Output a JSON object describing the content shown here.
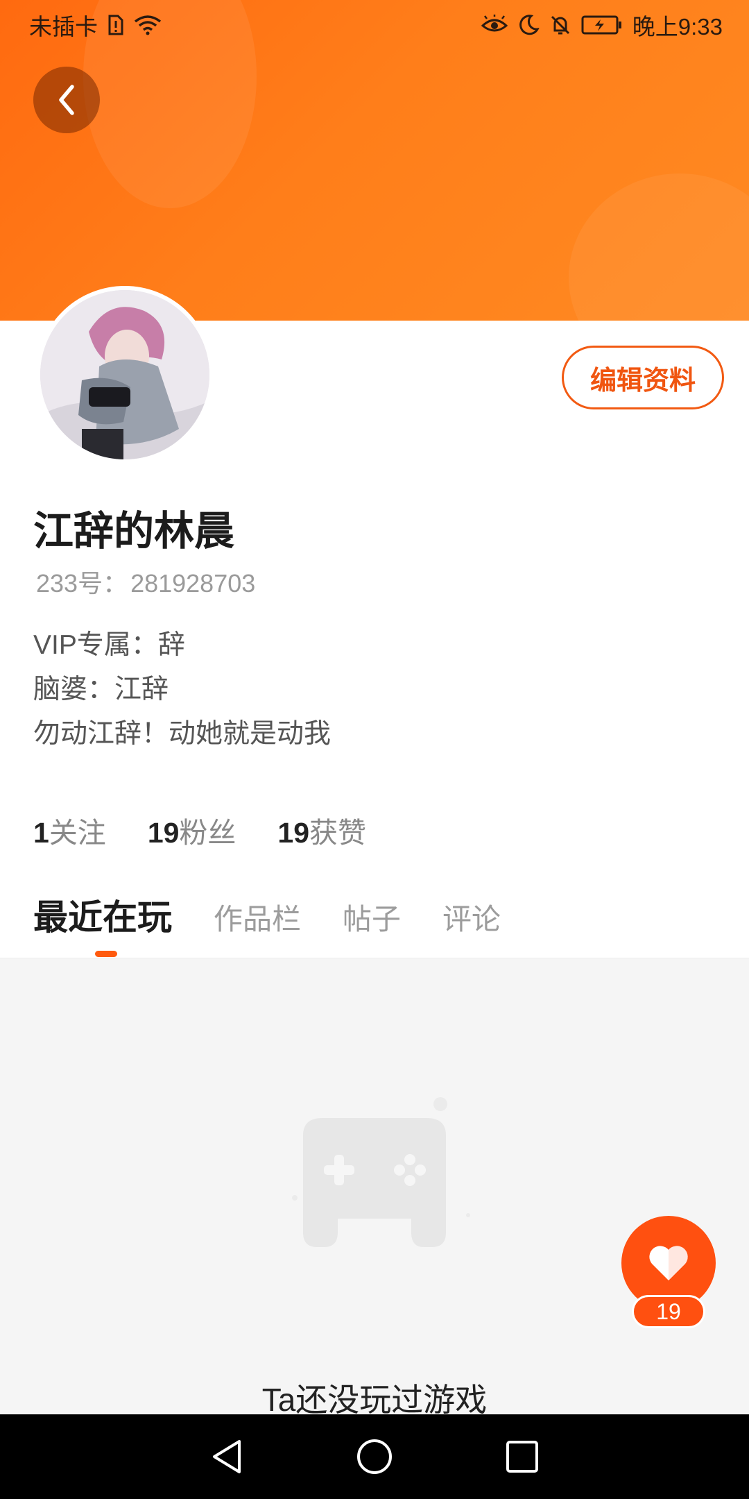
{
  "status_bar": {
    "carrier": "未插卡",
    "time": "晚上9:33",
    "icons": [
      "sim-alert-icon",
      "wifi-icon",
      "eye-icon",
      "moon-icon",
      "bell-off-icon",
      "battery-icon"
    ]
  },
  "header": {
    "back_icon": "chevron-left-icon"
  },
  "profile": {
    "edit_label": "编辑资料",
    "name": "江辞的林晨",
    "id_label": "233号：",
    "id_value": "281928703",
    "bio_lines": [
      "VIP专属：辞",
      "脑婆：江辞",
      "勿动江辞！动她就是动我"
    ]
  },
  "stats": [
    {
      "value": "1",
      "label": "关注"
    },
    {
      "value": "19",
      "label": "粉丝"
    },
    {
      "value": "19",
      "label": "获赞"
    }
  ],
  "tabs": [
    {
      "label": "最近在玩",
      "active": true
    },
    {
      "label": "作品栏",
      "active": false
    },
    {
      "label": "帖子",
      "active": false
    },
    {
      "label": "评论",
      "active": false
    }
  ],
  "empty_state": {
    "text": "Ta还没玩过游戏",
    "icon": "gamepad-icon"
  },
  "like": {
    "icon": "heart-icon",
    "count": "19"
  },
  "colors": {
    "accent": "#ff5a0e",
    "banner": "#ff7a18"
  }
}
